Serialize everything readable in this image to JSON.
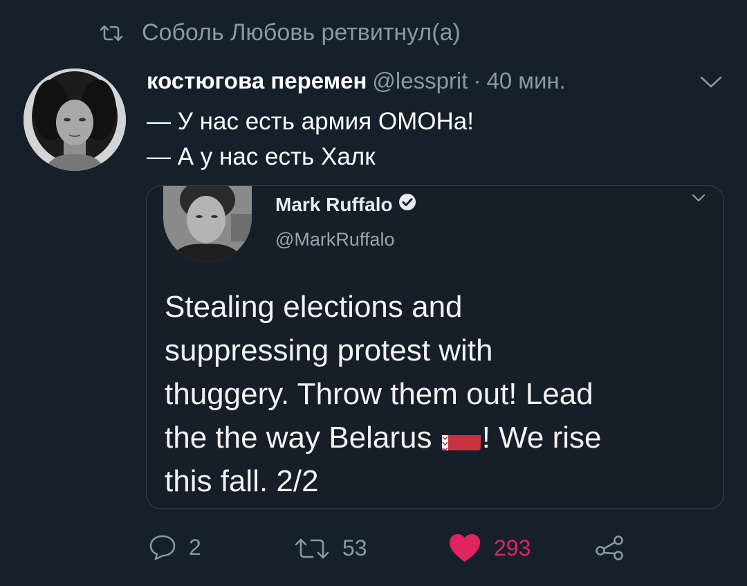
{
  "retweet_header": {
    "text": "Соболь Любовь ретвитнул(а)",
    "icon": "retweet-icon"
  },
  "tweet": {
    "display_name": "костюгова перемен",
    "handle": "@lessprit",
    "separator": "·",
    "time": "40 мин.",
    "lines": [
      "— У нас есть армия ОМОНа!",
      "— А у нас есть Халк"
    ]
  },
  "embedded": {
    "name": "Mark Ruffalo",
    "handle": "@MarkRuffalo",
    "lines": [
      "Stealing elections and",
      "suppressing protest with",
      "thuggery. Throw them out! Lead",
      "the the way Belarus",
      "! We rise",
      "this fall. 2/2"
    ],
    "flag_icon": "belarus-flag-icon"
  },
  "actions": {
    "reply_count": "2",
    "retweet_count": "53",
    "like_count": "293"
  },
  "colors": {
    "background": "#15202b",
    "secondary_text": "#8899a6",
    "like": "#e0245e",
    "border": "#38444d"
  }
}
